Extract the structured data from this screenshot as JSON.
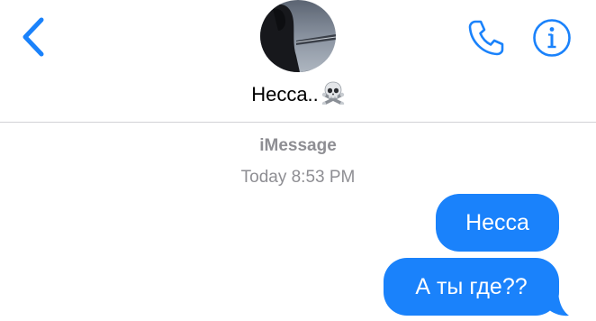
{
  "header": {
    "back_icon": "chevron-left-icon",
    "contact_name": "Несса..",
    "contact_emoji": "☠️",
    "call_icon": "phone-icon",
    "info_icon": "info-icon",
    "accent_color": "#1a82fb"
  },
  "thread": {
    "service_label": "iMessage",
    "timestamp": "Today 8:53 PM",
    "messages": [
      {
        "text": "Несса",
        "direction": "outgoing"
      },
      {
        "text": "А ты где??",
        "direction": "outgoing"
      }
    ],
    "bubble_color": "#1a82fb"
  }
}
